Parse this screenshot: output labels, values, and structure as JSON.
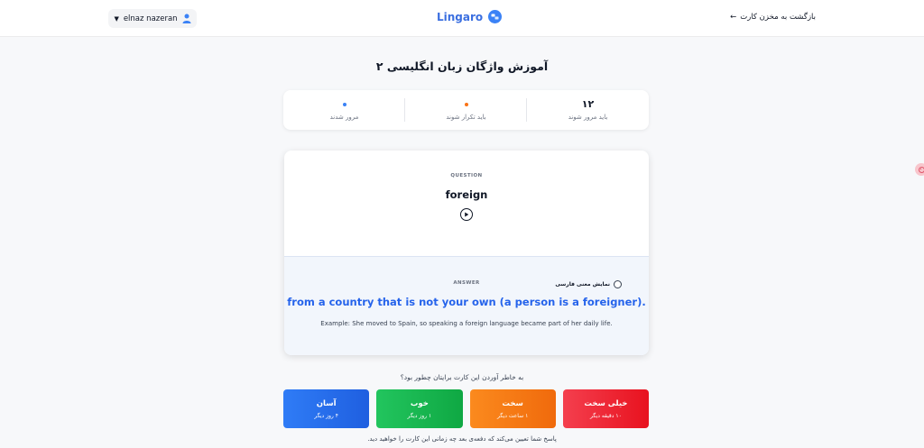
{
  "header": {
    "username": "elnaz nazeran",
    "logo_text": "Lingaro",
    "back_label": "بازگشت به مخزن کارت",
    "back_arrow": "←"
  },
  "title": "آموزش واژگان زبان انگلیسی ۲",
  "stats": [
    {
      "value": "۱۲",
      "label": "باید مرور شوند",
      "dot_color": ""
    },
    {
      "value": "",
      "label": "باید تکرار شوند",
      "dot_color": "#f97316"
    },
    {
      "value": "",
      "label": "مرور شدند",
      "dot_color": "#3b82f6"
    }
  ],
  "card": {
    "question_label": "QUESTION",
    "word": "foreign",
    "answer_label": "ANSWER",
    "toggle_label": "نمایش معنی فارسی",
    "answer": "from a country that is not your own (a person is a foreigner).",
    "example": "Example: She moved to Spain, so speaking a foreign language became part of her daily life."
  },
  "prompt": "به خاطر آوردن این کارت برایتان چطور بود؟",
  "ratings": [
    {
      "title": "خیلی سخت",
      "sub": "۱۰ دقیقه دیگر",
      "color": "#ef2a3a"
    },
    {
      "title": "سخت",
      "sub": "۱ ساعت دیگر",
      "color": "#f97316"
    },
    {
      "title": "خوب",
      "sub": "۱ روز دیگر",
      "color": "#16b34a"
    },
    {
      "title": "آسان",
      "sub": "۴ روز دیگر",
      "color": "#3b82f6"
    }
  ],
  "footer_note": "پاسخ شما تعیین می‌کند که دفعه‌ی بعد چه زمانی این کارت را خواهید دید.",
  "colors": {
    "brand": "#3b6fe0",
    "answer_text": "#2563eb"
  }
}
